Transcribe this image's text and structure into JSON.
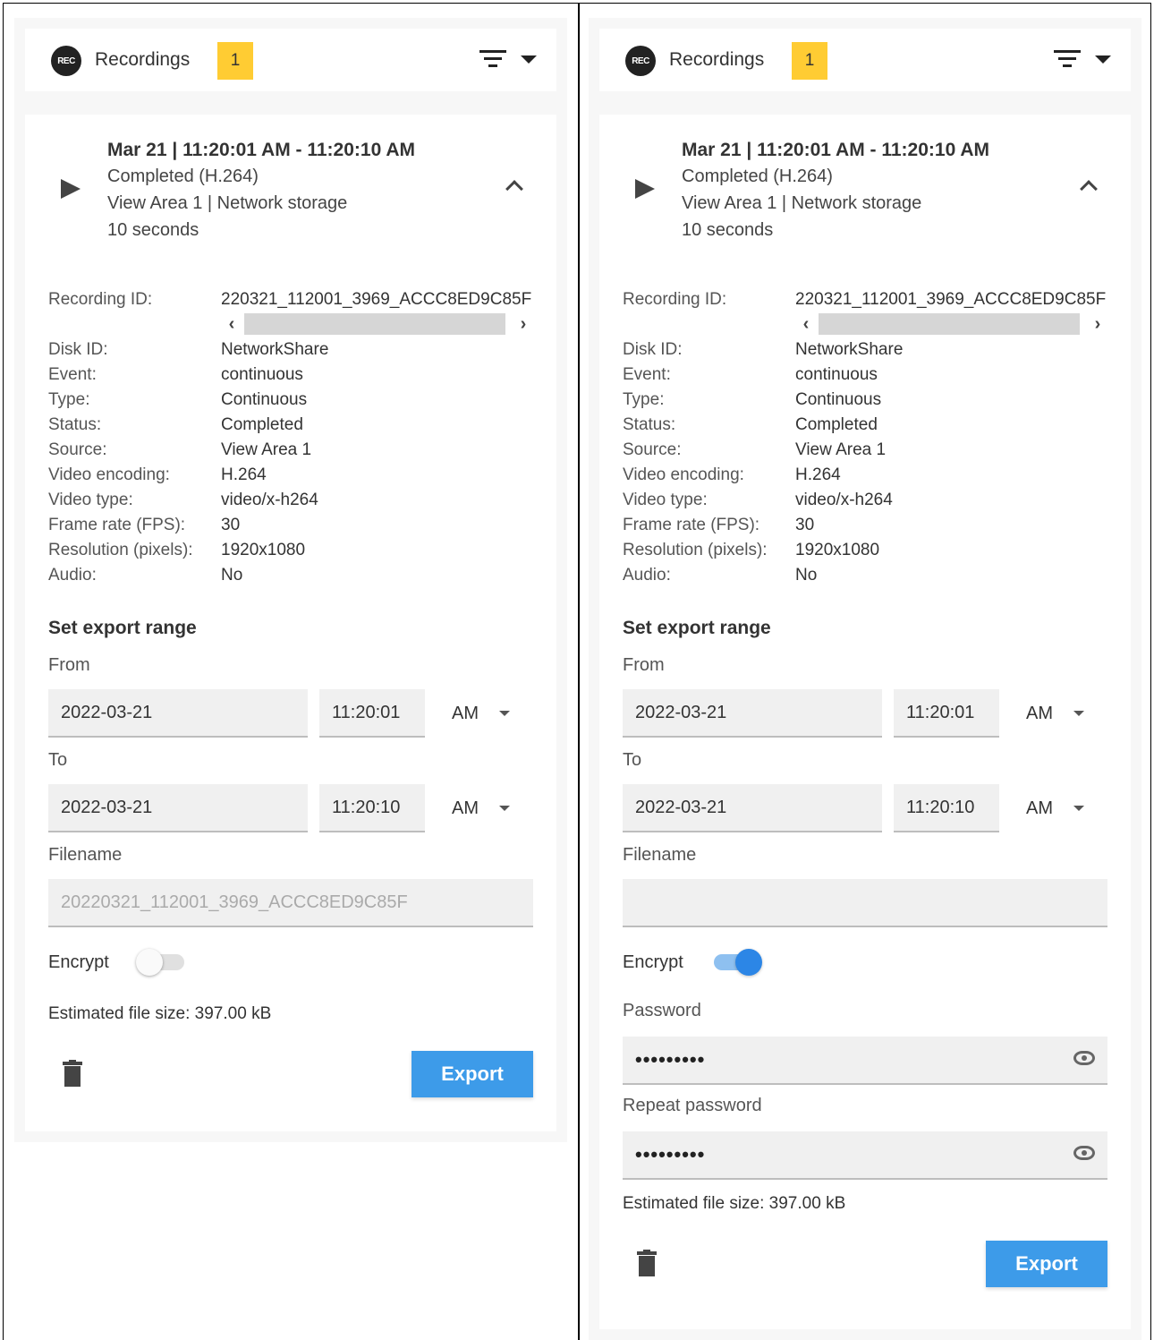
{
  "panels": [
    {
      "header": {
        "rec_icon": "REC",
        "title": "Recordings",
        "badge": "1"
      },
      "summary": {
        "title": "Mar 21 | 11:20:01 AM - 11:20:10 AM",
        "status": "Completed (H.264)",
        "location": "View Area 1 | Network storage",
        "duration": "10 seconds"
      },
      "details": [
        {
          "label": "Recording ID:",
          "value": "220321_112001_3969_ACCC8ED9C85F"
        },
        {
          "label": "Disk ID:",
          "value": "NetworkShare"
        },
        {
          "label": "Event:",
          "value": "continuous"
        },
        {
          "label": "Type:",
          "value": "Continuous"
        },
        {
          "label": "Status:",
          "value": "Completed"
        },
        {
          "label": "Source:",
          "value": "View Area 1"
        },
        {
          "label": "Video encoding:",
          "value": "H.264"
        },
        {
          "label": "Video type:",
          "value": "video/x-h264"
        },
        {
          "label": "Frame rate (FPS):",
          "value": "30"
        },
        {
          "label": "Resolution (pixels):",
          "value": "1920x1080"
        },
        {
          "label": "Audio:",
          "value": "No"
        }
      ],
      "export": {
        "title": "Set export range",
        "from_label": "From",
        "from_date": "2022-03-21",
        "from_time": "11:20:01",
        "from_ampm": "AM",
        "to_label": "To",
        "to_date": "2022-03-21",
        "to_time": "11:20:10",
        "to_ampm": "AM",
        "filename_label": "Filename",
        "filename_placeholder": "20220321_112001_3969_ACCC8ED9C85F",
        "filename_value": "",
        "encrypt_label": "Encrypt",
        "encrypt_on": false,
        "estimated_size": "Estimated file size: 397.00 kB",
        "export_label": "Export"
      }
    },
    {
      "header": {
        "rec_icon": "REC",
        "title": "Recordings",
        "badge": "1"
      },
      "summary": {
        "title": "Mar 21 | 11:20:01 AM - 11:20:10 AM",
        "status": "Completed (H.264)",
        "location": "View Area 1 | Network storage",
        "duration": "10 seconds"
      },
      "details": [
        {
          "label": "Recording ID:",
          "value": "220321_112001_3969_ACCC8ED9C85F"
        },
        {
          "label": "Disk ID:",
          "value": "NetworkShare"
        },
        {
          "label": "Event:",
          "value": "continuous"
        },
        {
          "label": "Type:",
          "value": "Continuous"
        },
        {
          "label": "Status:",
          "value": "Completed"
        },
        {
          "label": "Source:",
          "value": "View Area 1"
        },
        {
          "label": "Video encoding:",
          "value": "H.264"
        },
        {
          "label": "Video type:",
          "value": "video/x-h264"
        },
        {
          "label": "Frame rate (FPS):",
          "value": "30"
        },
        {
          "label": "Resolution (pixels):",
          "value": "1920x1080"
        },
        {
          "label": "Audio:",
          "value": "No"
        }
      ],
      "export": {
        "title": "Set export range",
        "from_label": "From",
        "from_date": "2022-03-21",
        "from_time": "11:20:01",
        "from_ampm": "AM",
        "to_label": "To",
        "to_date": "2022-03-21",
        "to_time": "11:20:10",
        "to_ampm": "AM",
        "filename_label": "Filename",
        "filename_placeholder": "",
        "filename_value": "",
        "encrypt_label": "Encrypt",
        "encrypt_on": true,
        "password_label": "Password",
        "password_dots": "•••••••••",
        "repeat_password_label": "Repeat password",
        "repeat_password_dots": "•••••••••",
        "estimated_size": "Estimated file size: 397.00 kB",
        "export_label": "Export"
      }
    }
  ],
  "icons": {
    "rec": "rec-icon",
    "filter": "filter-icon",
    "play": "play-icon",
    "collapse": "chevron-up-icon",
    "trash": "trash-icon",
    "eye": "eye-icon"
  },
  "colors": {
    "badge": "#ffcc33",
    "export_button": "#3d9be9",
    "toggle_on": "#2c86e6"
  }
}
